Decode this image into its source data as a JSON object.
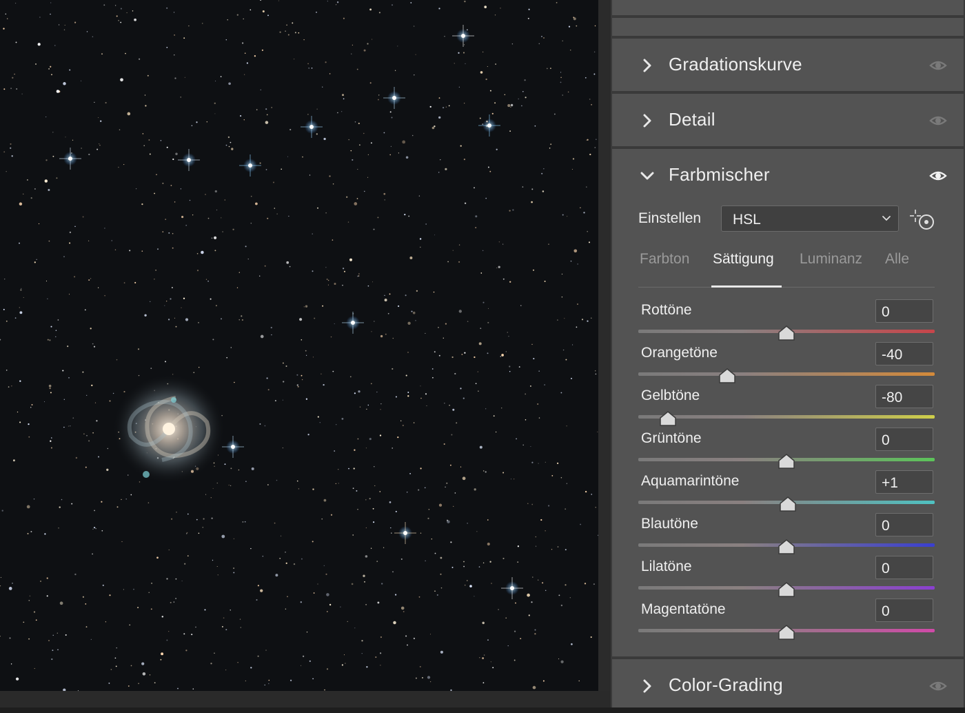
{
  "panel": {
    "sections": {
      "gradationskurve": {
        "title": "Gradationskurve",
        "expanded": false,
        "visible": false
      },
      "detail": {
        "title": "Detail",
        "expanded": false,
        "visible": false
      },
      "farbmischer": {
        "title": "Farbmischer",
        "expanded": true,
        "visible": true
      },
      "color_grading": {
        "title": "Color-Grading",
        "expanded": false,
        "visible": false
      }
    },
    "mixer": {
      "adjust_label": "Einstellen",
      "mode_value": "HSL",
      "tabs": [
        {
          "label": "Farbton",
          "active": false
        },
        {
          "label": "Sättigung",
          "active": true
        },
        {
          "label": "Luminanz",
          "active": false
        },
        {
          "label": "Alle",
          "active": false
        }
      ],
      "sliders": [
        {
          "label": "Rottöne",
          "value": "0",
          "num": 0,
          "color": "#c8454a"
        },
        {
          "label": "Orangetöne",
          "value": "-40",
          "num": -40,
          "color": "#d48a3a"
        },
        {
          "label": "Gelbtöne",
          "value": "-80",
          "num": -80,
          "color": "#cfcf4a"
        },
        {
          "label": "Grüntöne",
          "value": "0",
          "num": 0,
          "color": "#5cc45a"
        },
        {
          "label": "Aquamarintöne",
          "value": "+1",
          "num": 1,
          "color": "#4fc2c2"
        },
        {
          "label": "Blautöne",
          "value": "0",
          "num": 0,
          "color": "#3a3fd0"
        },
        {
          "label": "Lilatöne",
          "value": "0",
          "num": 0,
          "color": "#8a3fd0"
        },
        {
          "label": "Magentatöne",
          "value": "0",
          "num": 0,
          "color": "#d04aa8"
        }
      ]
    },
    "icons": {
      "collapsed": "chevron-right-icon",
      "expanded": "chevron-down-icon",
      "visibility": "eye-icon",
      "target_adjust": "targeted-adjustment-icon",
      "dropdown": "chevron-down-icon"
    }
  },
  "canvas": {
    "description_icon": "astro-photo-image"
  }
}
